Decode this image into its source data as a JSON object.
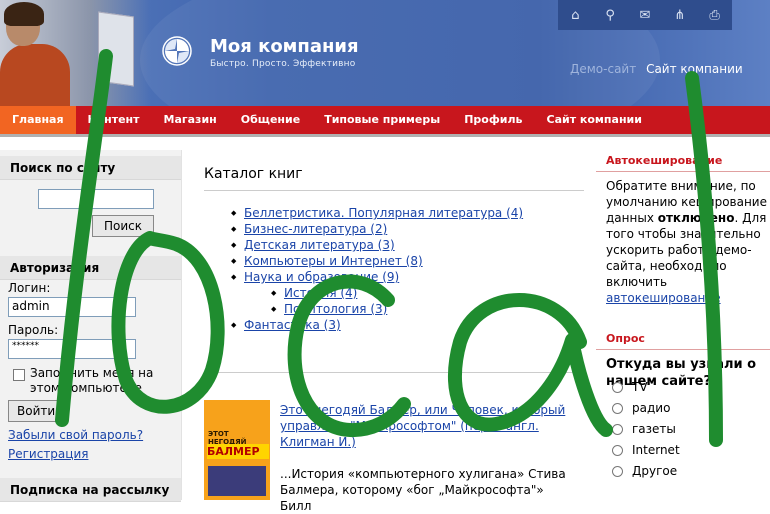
{
  "header": {
    "title": "Моя компания",
    "slogan": "Быстро. Просто. Эффективно",
    "demo_label": "Демо-сайт",
    "company_link": "Сайт компании",
    "icons": [
      "home-icon",
      "search-icon",
      "mail-icon",
      "sitemap-icon",
      "print-icon"
    ]
  },
  "nav": {
    "items": [
      "Главная",
      "Контент",
      "Магазин",
      "Общение",
      "Типовые примеры",
      "Профиль",
      "Сайт компании"
    ]
  },
  "search": {
    "title": "Поиск по сайту",
    "button": "Поиск"
  },
  "auth": {
    "title": "Авторизация",
    "login_label": "Логин:",
    "login_value": "admin",
    "password_label": "Пароль:",
    "password_value": "******",
    "remember_line1": "Запомнить меня на",
    "remember_line2": "этом компьютере",
    "login_button": "Войти",
    "forgot": "Забыли свой пароль?",
    "register": "Регистрация"
  },
  "subscribe": {
    "title": "Подписка на рассылку"
  },
  "catalog": {
    "title": "Каталог книг",
    "items": [
      {
        "label": "Беллетристика. Популярная литература (4)",
        "level": 1
      },
      {
        "label": "Бизнес-литература (2)",
        "level": 1
      },
      {
        "label": "Детская литература (3)",
        "level": 1
      },
      {
        "label": "Компьютеры и Интернет (8)",
        "level": 1
      },
      {
        "label": "Наука и образование (9)",
        "level": 1
      },
      {
        "label": "История (4)",
        "level": 2
      },
      {
        "label": "Политология (3)",
        "level": 2
      },
      {
        "label": "Фантастика (3)",
        "level": 1
      }
    ]
  },
  "book": {
    "cover_top": "ЭТОТ НЕГОДЯЙ",
    "cover_name": "БАЛМЕР",
    "title": "Этот негодяй Балмер, или Человек, который управляет \"Майкрософтом\" (пер. с англ. Клигман И.)",
    "desc": "...История «компьютерного хулигана» Стива Балмера, которому «бог „Майкрософта\"» Билл"
  },
  "right": {
    "cache_title": "Автокеширование",
    "cache_text_1": "Обратите внимание, по умолчанию кеширование данных ",
    "cache_text_bold": "отключено",
    "cache_text_2": ". Для того чтобы значительно ускорить работу демо-сайта, необходимо включить ",
    "cache_link": "автокеширование",
    "poll_title": "Опрос",
    "poll_question": "Откуда вы узнали о нашем сайте?",
    "options": [
      "TV",
      "радио",
      "газеты",
      "Internet",
      "Другое"
    ]
  },
  "colors": {
    "nav_red": "#c8161d",
    "nav_active": "#f26522",
    "header_blue": "#3e63ad",
    "link_blue": "#1a44a8",
    "scribble_green": "#1f8c2f"
  }
}
